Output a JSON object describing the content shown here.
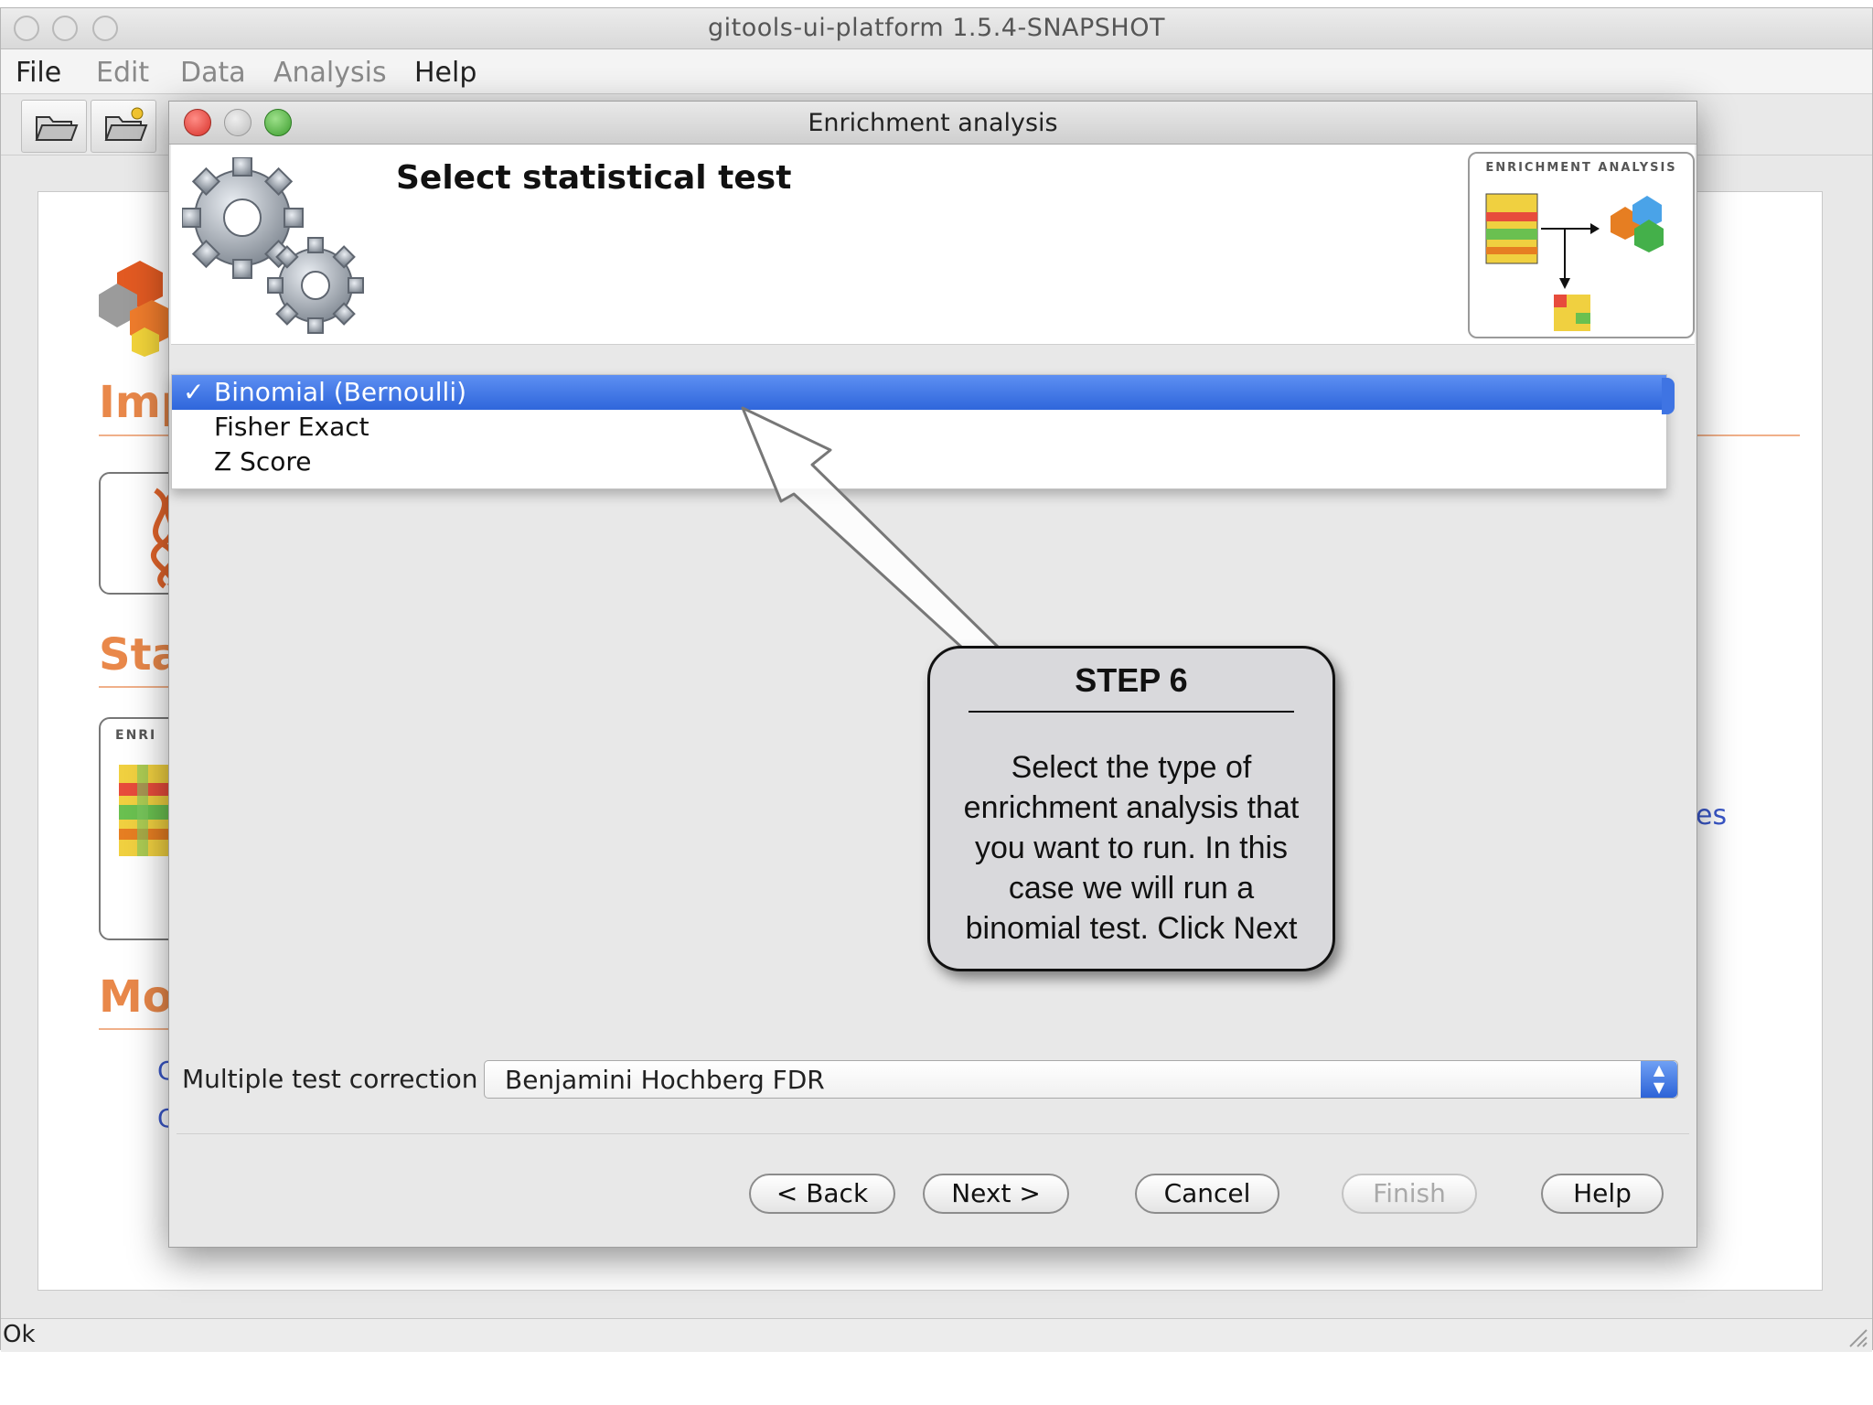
{
  "app": {
    "title": "gitools-ui-platform 1.5.4-SNAPSHOT",
    "menu": [
      {
        "label": "File",
        "enabled": true
      },
      {
        "label": "Edit",
        "enabled": false
      },
      {
        "label": "Data",
        "enabled": false
      },
      {
        "label": "Analysis",
        "enabled": false
      },
      {
        "label": "Help",
        "enabled": true
      }
    ],
    "background": {
      "headings": [
        "Imp",
        "Sta",
        "Mo"
      ],
      "card_label": "ENRI",
      "side_text": "es",
      "links": [
        "C",
        "C"
      ]
    },
    "status": "Ok"
  },
  "dialog": {
    "title": "Enrichment analysis",
    "header_title": "Select statistical test",
    "thumbnail_label": "ENRICHMENT ANALYSIS",
    "test_options": [
      {
        "label": "Binomial (Bernoulli)",
        "selected": true
      },
      {
        "label": "Fisher Exact",
        "selected": false
      },
      {
        "label": "Z Score",
        "selected": false
      }
    ],
    "check_mark": "✓",
    "correction_label": "Multiple test correction",
    "correction_value": "Benjamini Hochberg FDR",
    "buttons": {
      "back": "< Back",
      "next": "Next >",
      "cancel": "Cancel",
      "finish": "Finish",
      "help": "Help"
    }
  },
  "callout": {
    "title": "STEP 6",
    "text": "Select the type of enrichment analysis that you want to run. In this case we will run a binomial test. Click Next"
  },
  "colors": {
    "selection": "#3a6fe0",
    "accent_orange": "#e9884a",
    "close_red": "#e0443e",
    "zoom_green": "#56b94a"
  }
}
